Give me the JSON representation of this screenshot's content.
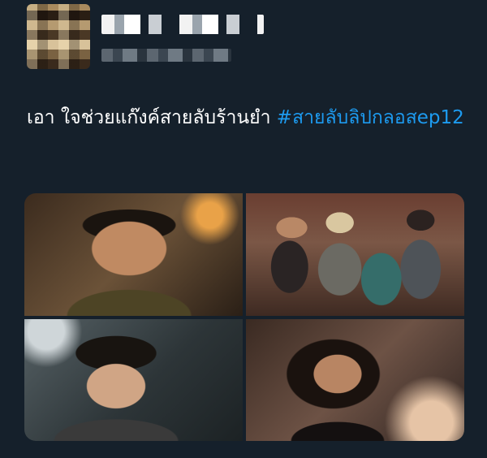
{
  "tweet": {
    "author": {
      "avatar_icon": "avatar-pixelated",
      "display_name_blurred": true,
      "handle_blurred": true
    },
    "text_main": "เอา ใจช่วยแก๊งค์สายลับร้านยำ ",
    "hashtag": "#สายลับลิปกลอสep12",
    "media": {
      "photos": [
        {
          "name": "photo-man-on-phone"
        },
        {
          "name": "photo-group-scene"
        },
        {
          "name": "photo-young-man"
        },
        {
          "name": "photo-woman-curly-hair"
        }
      ]
    },
    "colors": {
      "background": "#15202b",
      "text": "#ffffff",
      "hashtag": "#1d9bf0"
    }
  }
}
